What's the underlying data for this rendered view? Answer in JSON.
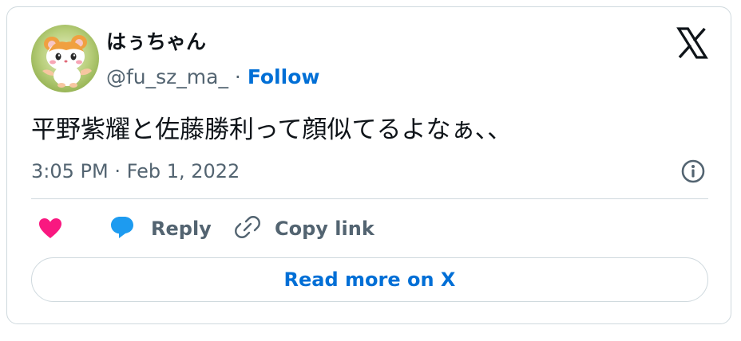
{
  "author": {
    "display_name": "はぅちゃん",
    "handle": "@fu_sz_ma_",
    "separator": " · ",
    "follow_label": "Follow",
    "avatar_icon": "hamster-avatar-icon"
  },
  "brand": {
    "logo_icon": "x-logo-icon"
  },
  "tweet": {
    "text": "平野紫耀と佐藤勝利って顔似てるよなぁ､､",
    "timestamp": "3:05 PM · Feb 1, 2022"
  },
  "actions": {
    "like_icon": "heart-icon",
    "reply_label": "Reply",
    "reply_icon": "speech-bubble-icon",
    "copy_label": "Copy link",
    "copy_icon": "link-icon",
    "info_icon": "info-icon"
  },
  "footer": {
    "read_more_label": "Read more on X"
  },
  "colors": {
    "accent": "#006fd6",
    "like": "#f91880",
    "reply": "#1d9bf0",
    "text": "#0f1419",
    "secondary": "#536471",
    "border": "#cfd9de"
  }
}
